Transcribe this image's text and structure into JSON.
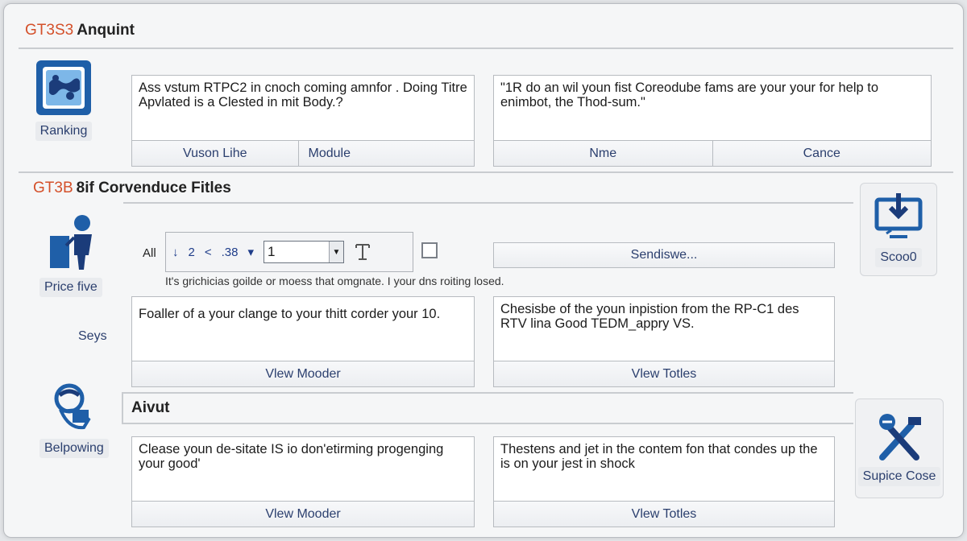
{
  "header": {
    "code": "GT3S3",
    "title": "Anquint"
  },
  "left_tiles": [
    {
      "label": "Ranking"
    },
    {
      "label": "Price five"
    },
    {
      "label": "Seys"
    },
    {
      "label": "Belpowing"
    }
  ],
  "right_tiles": [
    {
      "label": "Scoo0"
    },
    {
      "label": "Supice Cose"
    }
  ],
  "cards_top": [
    {
      "text": "Ass vstum RTPC2 in cnoch coming amnfor . Doing Titre Apvlated is a Clested in mit Body.?",
      "buttons": [
        "Vuson Lihe",
        "Module"
      ]
    },
    {
      "text": "\"1R do an wil youn fist Coreodube fams are your your for help to enimbot, the Thod-sum.\"",
      "buttons": [
        "Nme",
        "Cance"
      ]
    }
  ],
  "section2": {
    "code": "GT3B",
    "title": "8if Corvenduce Fitles"
  },
  "toolbar": {
    "all_label": "All",
    "tools": [
      "↓",
      "2",
      "<",
      ".38",
      "▾"
    ],
    "select_value": "1",
    "send_button": "Sendiswe...",
    "hint": "It's grichicias goilde or moess that omgnate. I your dns roiting losed."
  },
  "cards_mid": [
    {
      "text": "Foaller of a your clange to your thitt corder your 10.",
      "buttons": [
        "Vlew Mooder"
      ]
    },
    {
      "text": "Chesisbe of the youn inpistion from the RP-C1 des RTV lina Good TEDM_appry VS.",
      "buttons": [
        "Vlew Totles"
      ]
    }
  ],
  "section3": {
    "title": "Aivut"
  },
  "cards_bottom": [
    {
      "text": "Clease youn de-sitate IS io don'etirming progenging your good'",
      "buttons": [
        "Vlew Mooder"
      ]
    },
    {
      "text": "Thestens and jet in the contem fon that condes up the is on your jest in shock",
      "buttons": [
        "Vlew Totles"
      ]
    }
  ],
  "colors": {
    "accent": "#1f5fa8",
    "code": "#d4502a",
    "button_text": "#2b3f6e"
  },
  "icons": {
    "ranking": "image-map-icon",
    "price": "person-presenting-icon",
    "belpowing": "helmet-document-icon",
    "scoo": "download-monitor-icon",
    "supice": "tools-icon"
  }
}
